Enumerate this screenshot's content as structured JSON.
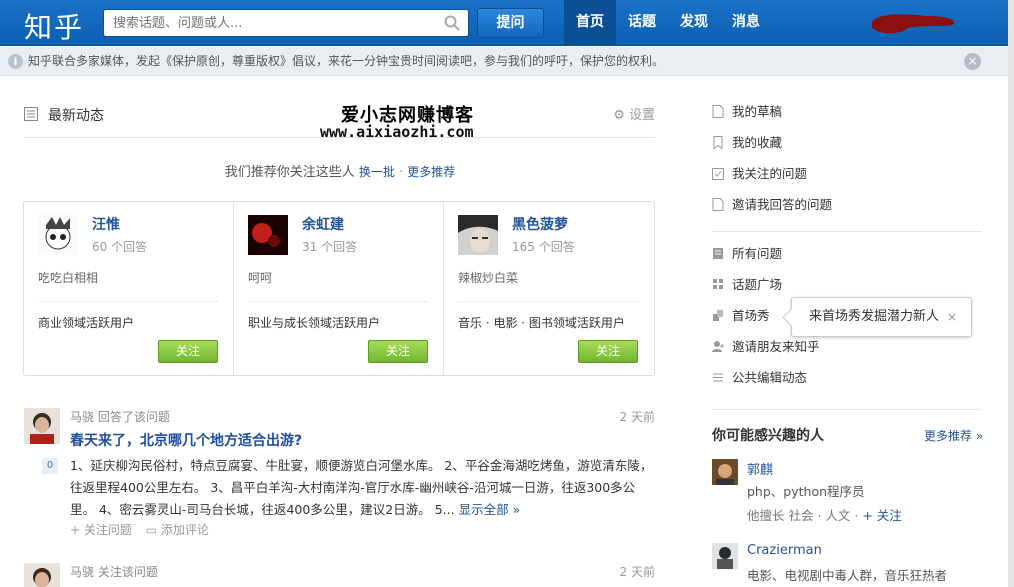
{
  "header": {
    "logo": "知乎",
    "search_placeholder": "搜索话题、问题或人...",
    "ask_label": "提问",
    "nav": [
      "首页",
      "话题",
      "发现",
      "消息"
    ]
  },
  "notice": {
    "text": "知乎联合多家媒体，发起《保护原创，尊重版权》倡议，来花一分钟宝贵时间阅读吧，参与我们的呼吁，保护您的权利。",
    "info": "i",
    "close": "×"
  },
  "feed": {
    "title": "最新动态",
    "settings": "设置"
  },
  "watermark": {
    "line1": "爱小志网赚博客",
    "line2": "www.aixiaozhi.com"
  },
  "recommend": {
    "text": "我们推荐你关注这些人",
    "swap": "换一批",
    "sep": " · ",
    "more": "更多推荐"
  },
  "cards": [
    {
      "name": "汪惟",
      "answers": "60 个回答",
      "bio": "吃吃白相相",
      "domain": "商业领域活跃用户",
      "follow": "关注"
    },
    {
      "name": "余虹建",
      "answers": "31 个回答",
      "bio": "呵呵",
      "domain": "职业与成长领域活跃用户",
      "follow": "关注"
    },
    {
      "name": "黑色菠萝",
      "answers": "165 个回答",
      "bio": "辣椒炒白菜",
      "domain": "音乐 · 电影 · 图书领域活跃用户",
      "follow": "关注"
    }
  ],
  "stories": [
    {
      "meta": "马骁 回答了该问题",
      "time": "2 天前",
      "question": "春天来了，北京哪几个地方适合出游?",
      "votes": "0",
      "body": "1、延庆柳沟民俗村，特点豆腐宴、牛肚宴，顺便游览白河堡水库。 2、平谷金海湖吃烤鱼，游览清东陵，往返里程400公里左右。 3、昌平白羊沟-大村南洋沟-官厅水库-幽州峡谷-沿河城一日游，往返300多公里。 4、密云雾灵山-司马台长城，往返400多公里，建议2日游。 5...",
      "show_all": "显示全部 »",
      "follow_q": "+ 关注问题",
      "comment": "添加评论"
    },
    {
      "meta": "马骁 关注该问题",
      "time": "2 天前"
    }
  ],
  "sidebar": {
    "items": [
      "我的草稿",
      "我的收藏",
      "我关注的问题",
      "邀请我回答的问题",
      "所有问题",
      "话题广场",
      "首场秀",
      "邀请朋友来知乎",
      "公共编辑动态"
    ],
    "tooltip": "来首场秀发掘潜力新人",
    "tooltip_close": "×",
    "maybe": "你可能感兴趣的人",
    "more": "更多推荐 »",
    "people": [
      {
        "name": "郭麒",
        "desc": "php、python程序员",
        "skill": "他擅长 社会 · 人文 · ",
        "follow": "关注"
      },
      {
        "name": "Crazierman",
        "desc": "电影、电视剧中毒人群，音乐狂热者"
      }
    ]
  },
  "colors": {
    "brand": "#0d5fb2",
    "link": "#225599",
    "follow_green": "#74b632"
  }
}
